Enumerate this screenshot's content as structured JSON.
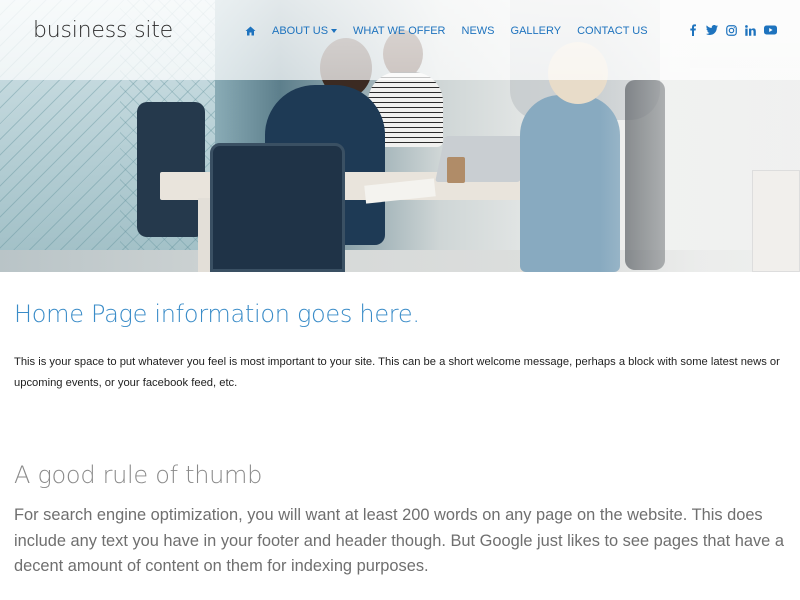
{
  "header": {
    "logo": "business site",
    "nav": [
      {
        "label": "About Us",
        "has_dropdown": true
      },
      {
        "label": "What We Offer",
        "has_dropdown": false
      },
      {
        "label": "News",
        "has_dropdown": false
      },
      {
        "label": "Gallery",
        "has_dropdown": false
      },
      {
        "label": "Contact Us",
        "has_dropdown": false
      }
    ],
    "home_icon": "home-icon",
    "social": [
      "facebook-icon",
      "twitter-icon",
      "instagram-icon",
      "linkedin-icon",
      "youtube-icon"
    ]
  },
  "hero": {
    "description": "Office meeting scene: colleagues around a table with laptops"
  },
  "content": {
    "heading": "Home Page information goes here.",
    "intro": "This is your space to put whatever you feel is most important to your site. This can be a short welcome message, perhaps a block with some latest news or upcoming events, or your facebook feed, etc.",
    "subheading": "A good rule of thumb",
    "body": "For search engine optimization, you will want at least 200 words on any page on the website. This does include any text you have in your footer and header though. But Google just likes to see pages that have a decent amount of content on them for indexing purposes."
  },
  "colors": {
    "accent": "#1e73be",
    "heading": "#3a8cc8",
    "subheading": "#8a8a8a",
    "body_text": "#6f6f6f"
  }
}
